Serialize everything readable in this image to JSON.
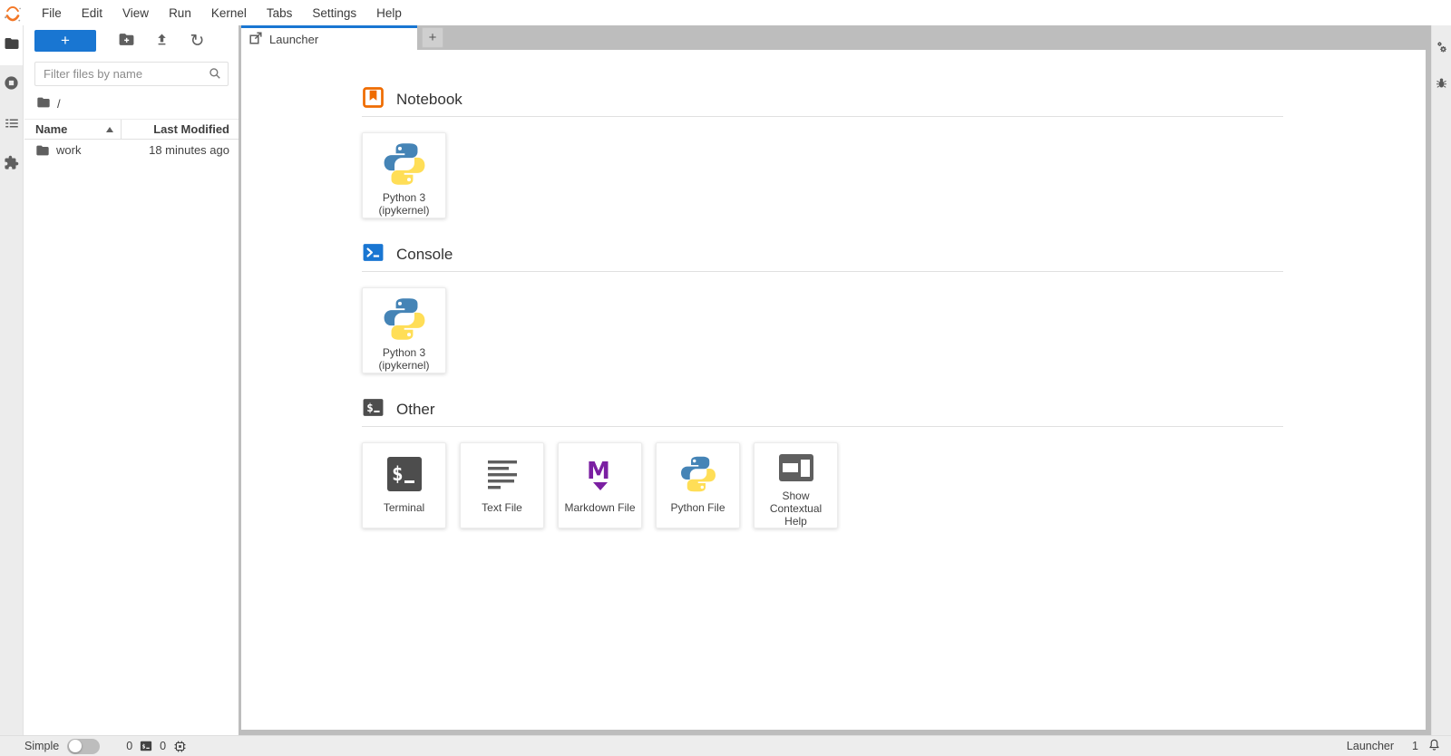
{
  "colors": {
    "accent_blue": "#1976d2",
    "notebook_orange": "#ef6c00",
    "markdown_purple": "#7b1fa2",
    "icon_gray": "#5f5f5f",
    "tabbar_gray": "#bdbdbd",
    "python_blue": "#4584b6",
    "python_yellow": "#ffde57",
    "jupyter_orange": "#f37726"
  },
  "menubar": {
    "items": [
      "File",
      "Edit",
      "View",
      "Run",
      "Kernel",
      "Tabs",
      "Settings",
      "Help"
    ]
  },
  "left_activity_bar": {
    "tabs": [
      {
        "name": "file-browser",
        "icon": "folder-icon",
        "active": true
      },
      {
        "name": "running-sessions",
        "icon": "stop-circle-icon",
        "active": false
      },
      {
        "name": "table-of-contents",
        "icon": "list-icon",
        "active": false
      },
      {
        "name": "extension-manager",
        "icon": "puzzle-icon",
        "active": false
      }
    ]
  },
  "right_activity_bar": {
    "tabs": [
      {
        "name": "property-inspector",
        "icon": "gears-icon"
      },
      {
        "name": "debugger",
        "icon": "bug-icon"
      }
    ]
  },
  "file_browser": {
    "toolbar": {
      "new_launcher_label": "+",
      "buttons": [
        "new-folder",
        "upload",
        "refresh"
      ]
    },
    "filter_placeholder": "Filter files by name",
    "breadcrumb_root": "/",
    "header": {
      "name": "Name",
      "last_modified": "Last Modified"
    },
    "rows": [
      {
        "name": "work",
        "last_modified": "18 minutes ago",
        "icon": "folder-icon"
      }
    ]
  },
  "tab_bar": {
    "tabs": [
      {
        "label": "Launcher",
        "icon": "launcher-icon",
        "active": true
      }
    ],
    "add_label": "+"
  },
  "launcher": {
    "sections": [
      {
        "title": "Notebook",
        "icon": "notebook-icon",
        "cards": [
          {
            "label": "Python 3 (ipykernel)",
            "icon": "python-logo"
          }
        ]
      },
      {
        "title": "Console",
        "icon": "console-icon",
        "cards": [
          {
            "label": "Python 3 (ipykernel)",
            "icon": "python-logo"
          }
        ]
      },
      {
        "title": "Other",
        "icon": "terminal-icon",
        "cards": [
          {
            "label": "Terminal",
            "icon": "terminal-icon"
          },
          {
            "label": "Text File",
            "icon": "text-file-icon"
          },
          {
            "label": "Markdown File",
            "icon": "markdown-icon"
          },
          {
            "label": "Python File",
            "icon": "python-logo"
          },
          {
            "label": "Show Contextual Help",
            "icon": "contextual-help-icon"
          }
        ]
      }
    ]
  },
  "status_bar": {
    "mode_label": "Simple",
    "mode_toggle_on": false,
    "terminals_count": "0",
    "kernels_count": "0",
    "current_activity": "Launcher",
    "notifications_count": "1"
  }
}
